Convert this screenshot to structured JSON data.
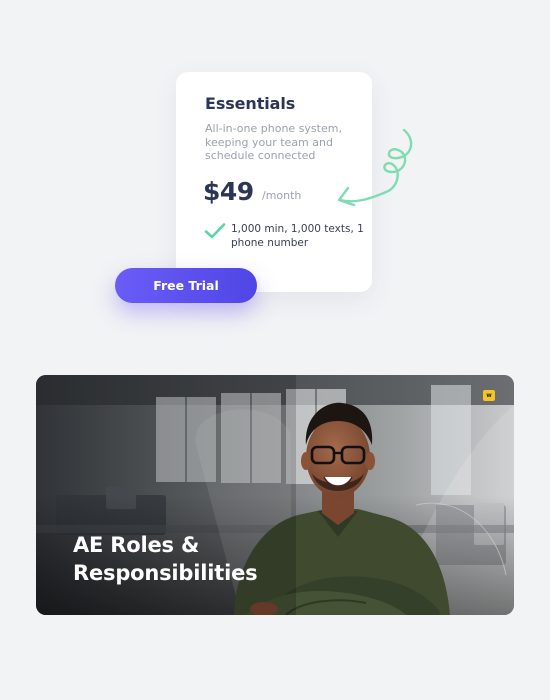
{
  "pricing_card": {
    "plan_name": "Essentials",
    "description": "All-in-one phone system, keeping your team and schedule connected",
    "price": "$49",
    "period": "/month",
    "feature": "1,000 min, 1,000 texts, 1 phone number"
  },
  "cta": {
    "label": "Free Trial"
  },
  "banner": {
    "title_line1": "AE Roles &",
    "title_line2": "Responsibilities",
    "badge": "w"
  },
  "colors": {
    "background": "#f2f3f5",
    "heading": "#2c3555",
    "muted_text": "#9aa1b0",
    "check": "#5bd6a3",
    "button_gradient_start": "#6b5cf7",
    "button_gradient_end": "#4f46e5",
    "squiggle": "#7fdcb0",
    "badge": "#f3c624"
  },
  "icons": {
    "check": "check-icon",
    "squiggle": "squiggle-arrow-icon",
    "badge": "brand-logo-icon"
  }
}
